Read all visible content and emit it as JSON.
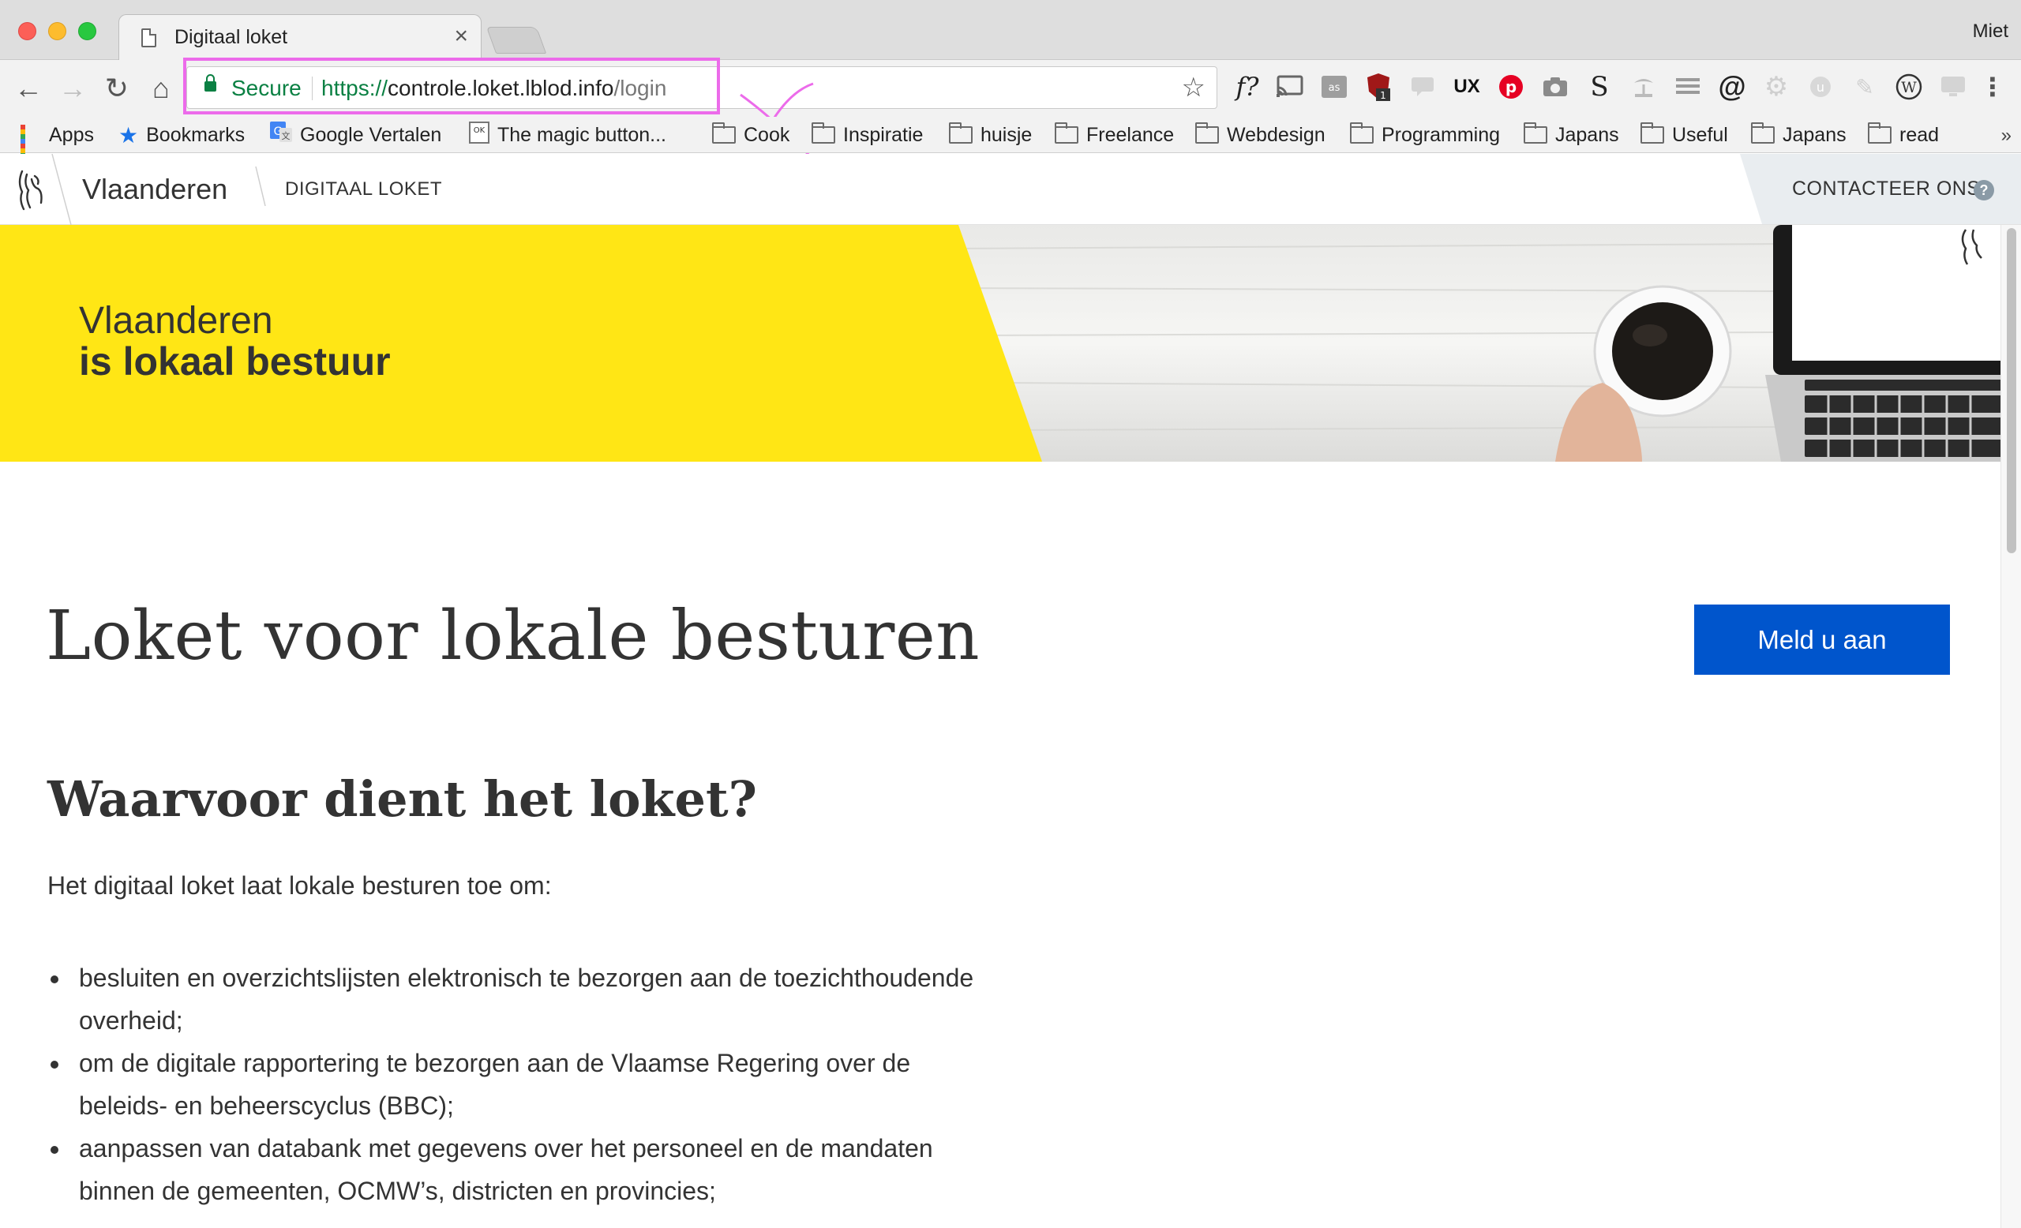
{
  "browser": {
    "tab_title": "Digitaal loket",
    "tab_close": "×",
    "profile": "Miet",
    "secure_label": "Secure",
    "url_scheme": "https://",
    "url_host": "controle.loket.lblod.info",
    "url_path": "/login",
    "bookmarks": [
      {
        "label": "Apps",
        "icon": "apps-grid-icon"
      },
      {
        "label": "Bookmarks",
        "icon": "star-icon"
      },
      {
        "label": "Google Vertalen",
        "icon": "google-translate-icon"
      },
      {
        "label": "The magic button...",
        "icon": "ok-page-icon"
      },
      {
        "label": "Cook",
        "icon": "folder-icon"
      },
      {
        "label": "Inspiratie",
        "icon": "folder-icon"
      },
      {
        "label": "huisje",
        "icon": "folder-icon"
      },
      {
        "label": "Freelance",
        "icon": "folder-icon"
      },
      {
        "label": "Webdesign",
        "icon": "folder-icon"
      },
      {
        "label": "Programming",
        "icon": "folder-icon"
      },
      {
        "label": "Japans",
        "icon": "folder-icon"
      },
      {
        "label": "Useful",
        "icon": "folder-icon"
      },
      {
        "label": "Japans",
        "icon": "folder-icon"
      },
      {
        "label": "read",
        "icon": "folder-icon"
      }
    ],
    "bookmarks_more": "»",
    "extensions": [
      "f?",
      "",
      "",
      "1",
      "",
      "UX",
      "",
      "",
      "S",
      "",
      "",
      "@",
      "",
      "",
      "",
      "W",
      "",
      "⋮"
    ]
  },
  "site": {
    "brand": "Vlaanderen",
    "app_title": "DIGITAAL LOKET",
    "contact_label": "CONTACTEER ONS",
    "help_glyph": "?",
    "hero_line1": "Vlaanderen",
    "hero_line2": "is lokaal bestuur"
  },
  "main": {
    "title": "Loket voor lokale besturen",
    "login_button": "Meld u aan",
    "section_title": "Waarvoor dient het loket?",
    "intro": "Het digitaal loket laat lokale besturen toe om:",
    "items": [
      "besluiten en overzichtslijsten elektronisch te bezorgen aan de toezichthoudende overheid;",
      "om de digitale rapportering te bezorgen aan de Vlaamse Regering over de beleids- en beheerscyclus (BBC);",
      "aanpassen van databank met gegevens over het personeel en de mandaten binnen de gemeenten, OCMW’s, districten en provincies;"
    ]
  },
  "colors": {
    "hero_yellow": "#ffe615",
    "button_blue": "#0055cc",
    "secure_green": "#0b8043",
    "annotation_pink": "#ec6bea"
  }
}
